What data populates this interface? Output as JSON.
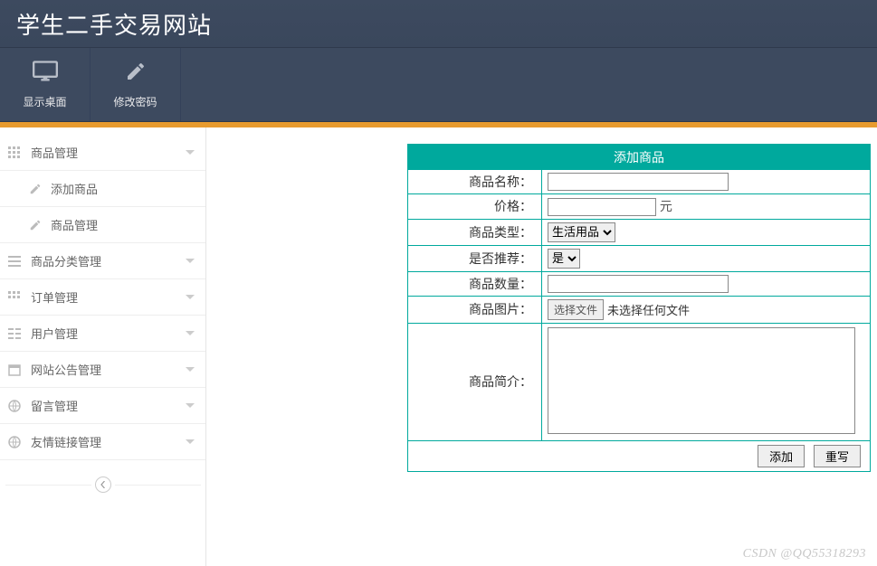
{
  "header": {
    "title": "学生二手交易网站"
  },
  "toolbar": {
    "desktop": "显示桌面",
    "password": "修改密码"
  },
  "sidebar": {
    "items": [
      {
        "label": "商品管理",
        "icon": "grid"
      },
      {
        "label": "商品分类管理",
        "icon": "list"
      },
      {
        "label": "订单管理",
        "icon": "grid"
      },
      {
        "label": "用户管理",
        "icon": "users"
      },
      {
        "label": "网站公告管理",
        "icon": "calendar"
      },
      {
        "label": "留言管理",
        "icon": "globe"
      },
      {
        "label": "友情链接管理",
        "icon": "globe"
      }
    ],
    "submenu0": [
      {
        "label": "添加商品"
      },
      {
        "label": "商品管理"
      }
    ]
  },
  "form": {
    "title": "添加商品",
    "labels": {
      "name": "商品名称：",
      "price": "价格：",
      "price_unit": "元",
      "type": "商品类型：",
      "recommend": "是否推荐：",
      "quantity": "商品数量：",
      "image": "商品图片：",
      "desc": "商品简介："
    },
    "values": {
      "name": "",
      "price": "",
      "type_selected": "生活用品",
      "recommend_selected": "是",
      "quantity": "",
      "file_button": "选择文件",
      "file_status": "未选择任何文件",
      "desc": ""
    },
    "buttons": {
      "submit": "添加",
      "reset": "重写"
    }
  },
  "watermark": "CSDN @QQ55318293"
}
